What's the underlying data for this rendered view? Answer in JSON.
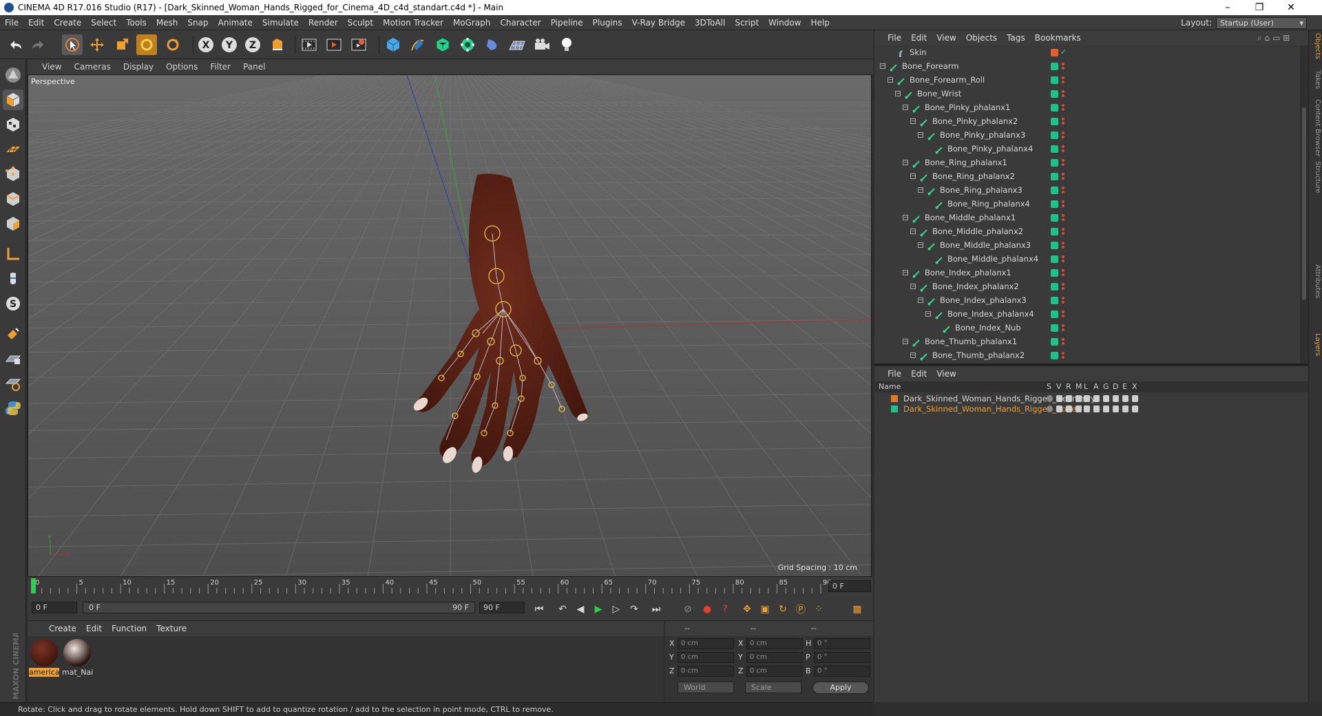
{
  "window": {
    "title": "CINEMA 4D R17.016 Studio (R17) - [Dark_Skinned_Woman_Hands_Rigged_for_Cinema_4D_c4d_standart.c4d *] - Main",
    "minimize": "–",
    "maximize": "❐",
    "close": "✕"
  },
  "menubar": {
    "items": [
      "File",
      "Edit",
      "Create",
      "Select",
      "Tools",
      "Mesh",
      "Snap",
      "Animate",
      "Simulate",
      "Render",
      "Sculpt",
      "Motion Tracker",
      "MoGraph",
      "Character",
      "Pipeline",
      "Plugins",
      "V-Ray Bridge",
      "3DToAll",
      "Script",
      "Window",
      "Help"
    ],
    "layout_label": "Layout:",
    "layout_value": "Startup (User)"
  },
  "viewport": {
    "menu": [
      "View",
      "Cameras",
      "Display",
      "Options",
      "Filter",
      "Panel"
    ],
    "camera_label": "Perspective",
    "grid_spacing": "Grid Spacing : 10 cm",
    "axis_y": "Y",
    "axis_x": "X"
  },
  "timeline": {
    "ticks": [
      "0",
      "5",
      "10",
      "15",
      "20",
      "25",
      "30",
      "35",
      "40",
      "45",
      "50",
      "55",
      "60",
      "65",
      "70",
      "75",
      "80",
      "85",
      "90"
    ],
    "current_frame": "0 F",
    "start_field": "0 F",
    "range_start": "0 F",
    "range_end": "90 F",
    "end_field": "90 F"
  },
  "material_manager": {
    "menu": [
      "Create",
      "Edit",
      "Function",
      "Texture"
    ],
    "materials": [
      {
        "name": "america",
        "color": "#5a1f14"
      },
      {
        "name": "mat_Nai",
        "color": "#d8c4bc"
      }
    ]
  },
  "coordinates": {
    "headers": [
      "--",
      "--",
      "--"
    ],
    "rows": [
      {
        "a": "X",
        "av": "0 cm",
        "b": "X",
        "bv": "0 cm",
        "c": "H",
        "cv": "0 °"
      },
      {
        "a": "Y",
        "av": "0 cm",
        "b": "Y",
        "bv": "0 cm",
        "c": "P",
        "cv": "0 °"
      },
      {
        "a": "Z",
        "av": "0 cm",
        "b": "Z",
        "bv": "0 cm",
        "c": "B",
        "cv": "0 °"
      }
    ],
    "world": "World",
    "scale": "Scale",
    "apply": "Apply"
  },
  "status_text": "Rotate: Click and drag to rotate elements. Hold down SHIFT to add to quantize rotation / add to the selection in point mode, CTRL to remove.",
  "object_manager": {
    "menu": [
      "File",
      "Edit",
      "View",
      "Objects",
      "Tags",
      "Bookmarks"
    ],
    "objects": [
      {
        "name": "Skin",
        "depth": 3,
        "skin": true
      },
      {
        "name": "Bone_Forearm",
        "depth": 2
      },
      {
        "name": "Bone_Forearm_Roll",
        "depth": 3
      },
      {
        "name": "Bone_Wrist",
        "depth": 4
      },
      {
        "name": "Bone_Pinky_phalanx1",
        "depth": 5
      },
      {
        "name": "Bone_Pinky_phalanx2",
        "depth": 6
      },
      {
        "name": "Bone_Pinky_phalanx3",
        "depth": 7
      },
      {
        "name": "Bone_Pinky_phalanx4",
        "depth": 8
      },
      {
        "name": "Bone_Ring_phalanx1",
        "depth": 5
      },
      {
        "name": "Bone_Ring_phalanx2",
        "depth": 6
      },
      {
        "name": "Bone_Ring_phalanx3",
        "depth": 7
      },
      {
        "name": "Bone_Ring_phalanx4",
        "depth": 8
      },
      {
        "name": "Bone_Middle_phalanx1",
        "depth": 5
      },
      {
        "name": "Bone_Middle_phalanx2",
        "depth": 6
      },
      {
        "name": "Bone_Middle_phalanx3",
        "depth": 7
      },
      {
        "name": "Bone_Middle_phalanx4",
        "depth": 8
      },
      {
        "name": "Bone_Index_phalanx1",
        "depth": 5
      },
      {
        "name": "Bone_Index_phalanx2",
        "depth": 6
      },
      {
        "name": "Bone_Index_phalanx3",
        "depth": 7
      },
      {
        "name": "Bone_Index_phalanx4",
        "depth": 8
      },
      {
        "name": "Bone_Index_Nub",
        "depth": 9
      },
      {
        "name": "Bone_Thumb_phalanx1",
        "depth": 5
      },
      {
        "name": "Bone_Thumb_phalanx2",
        "depth": 6
      }
    ]
  },
  "layer_manager": {
    "menu": [
      "File",
      "Edit",
      "View"
    ],
    "columns": [
      "Name",
      "S",
      "V",
      "R",
      "M",
      "L",
      "A",
      "G",
      "D",
      "E",
      "X"
    ],
    "layers": [
      {
        "name": "Dark_Skinned_Woman_Hands_Rigged_Geometry",
        "color": "#e0782a",
        "text_color": "#d6d6d6"
      },
      {
        "name": "Dark_Skinned_Woman_Hands_Rigged_Bones",
        "color": "#21c08a",
        "text_color": "#f0a030"
      }
    ]
  },
  "right_tabs": [
    "Objects",
    "Takes",
    "Content Browser",
    "Structure",
    "Attributes",
    "Layers"
  ],
  "branding": "MAXON CINEMA 4D",
  "colors": {
    "accent_orange": "#f0a030",
    "tag_green": "#21c08a",
    "skin": "#5a2318"
  }
}
